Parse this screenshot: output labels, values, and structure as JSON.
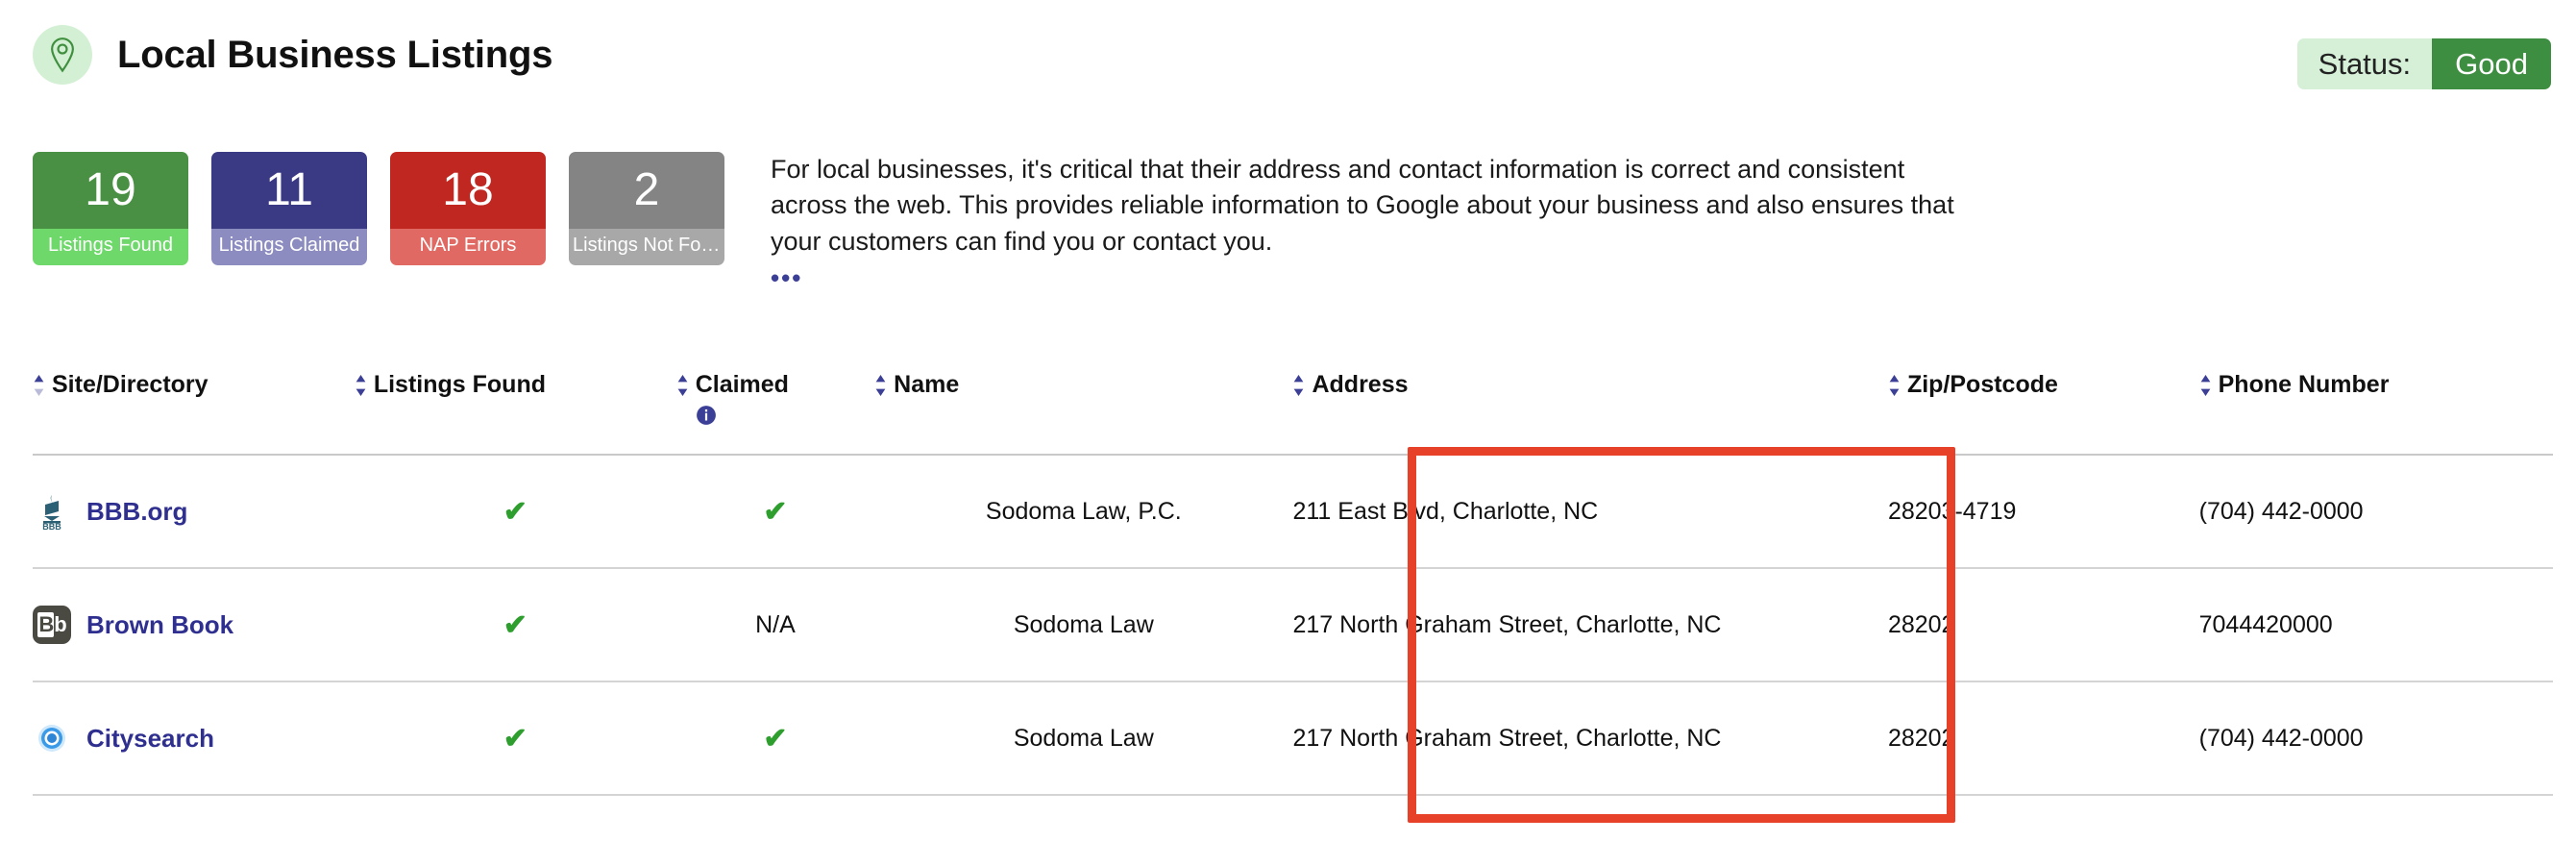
{
  "header": {
    "title": "Local Business Listings",
    "pin_icon": "map-pin-icon",
    "status_label": "Status:",
    "status_value": "Good",
    "status_label_bg": "#d6f0d8",
    "status_value_bg": "#3e8e41"
  },
  "cards": [
    {
      "value": "19",
      "label": "Listings Found",
      "top_bg": "#4a9044",
      "bottom_bg": "#6ed86a"
    },
    {
      "value": "11",
      "label": "Listings Claimed",
      "top_bg": "#3a3a84",
      "bottom_bg": "#8c8cc0"
    },
    {
      "value": "18",
      "label": "NAP Errors",
      "top_bg": "#bf2720",
      "bottom_bg": "#e06a63"
    },
    {
      "value": "2",
      "label": "Listings Not Fou…",
      "top_bg": "#848484",
      "bottom_bg": "#a8a8a8"
    }
  ],
  "description": {
    "text": "For local businesses, it's critical that their address and contact information is correct and consistent across the web. This provides reliable information to Google about your business and also ensures that your customers can find you or contact you.",
    "more_label": "•••"
  },
  "table": {
    "columns": [
      {
        "label": "Site/Directory",
        "sortable": true,
        "info": false
      },
      {
        "label": "Listings Found",
        "sortable": true,
        "info": false
      },
      {
        "label": "Claimed",
        "sortable": true,
        "info": true
      },
      {
        "label": "Name",
        "sortable": true,
        "info": false
      },
      {
        "label": "Address",
        "sortable": true,
        "info": false
      },
      {
        "label": "Zip/Postcode",
        "sortable": true,
        "info": false
      },
      {
        "label": "Phone Number",
        "sortable": true,
        "info": false
      }
    ],
    "rows": [
      {
        "site": "BBB.org",
        "logo": "bbb-torch-icon",
        "listings_found": "✔",
        "claimed": "✔",
        "name": "Sodoma Law, P.C.",
        "name_error": true,
        "address": "211 East Blvd, Charlotte, NC",
        "address_error": true,
        "zip": "28203-4719",
        "zip_error": true,
        "phone": "(704) 442-0000",
        "phone_error": false
      },
      {
        "site": "Brown Book",
        "logo": "brownbook-bb-icon",
        "listings_found": "✔",
        "claimed": "N/A",
        "name": "Sodoma Law",
        "name_error": false,
        "address": "217 North Graham Street, Charlotte, NC",
        "address_error": false,
        "zip": "28202",
        "zip_error": false,
        "phone": "7044420000",
        "phone_error": false
      },
      {
        "site": "Citysearch",
        "logo": "citysearch-eye-icon",
        "listings_found": "✔",
        "claimed": "✔",
        "name": "Sodoma Law",
        "name_error": false,
        "address": "217 North Graham Street, Charlotte, NC",
        "address_error": false,
        "zip": "28202",
        "zip_error": false,
        "phone": "(704) 442-0000",
        "phone_error": false
      }
    ]
  },
  "annotation": {
    "color": "#e8412a",
    "target_column": "Address"
  }
}
